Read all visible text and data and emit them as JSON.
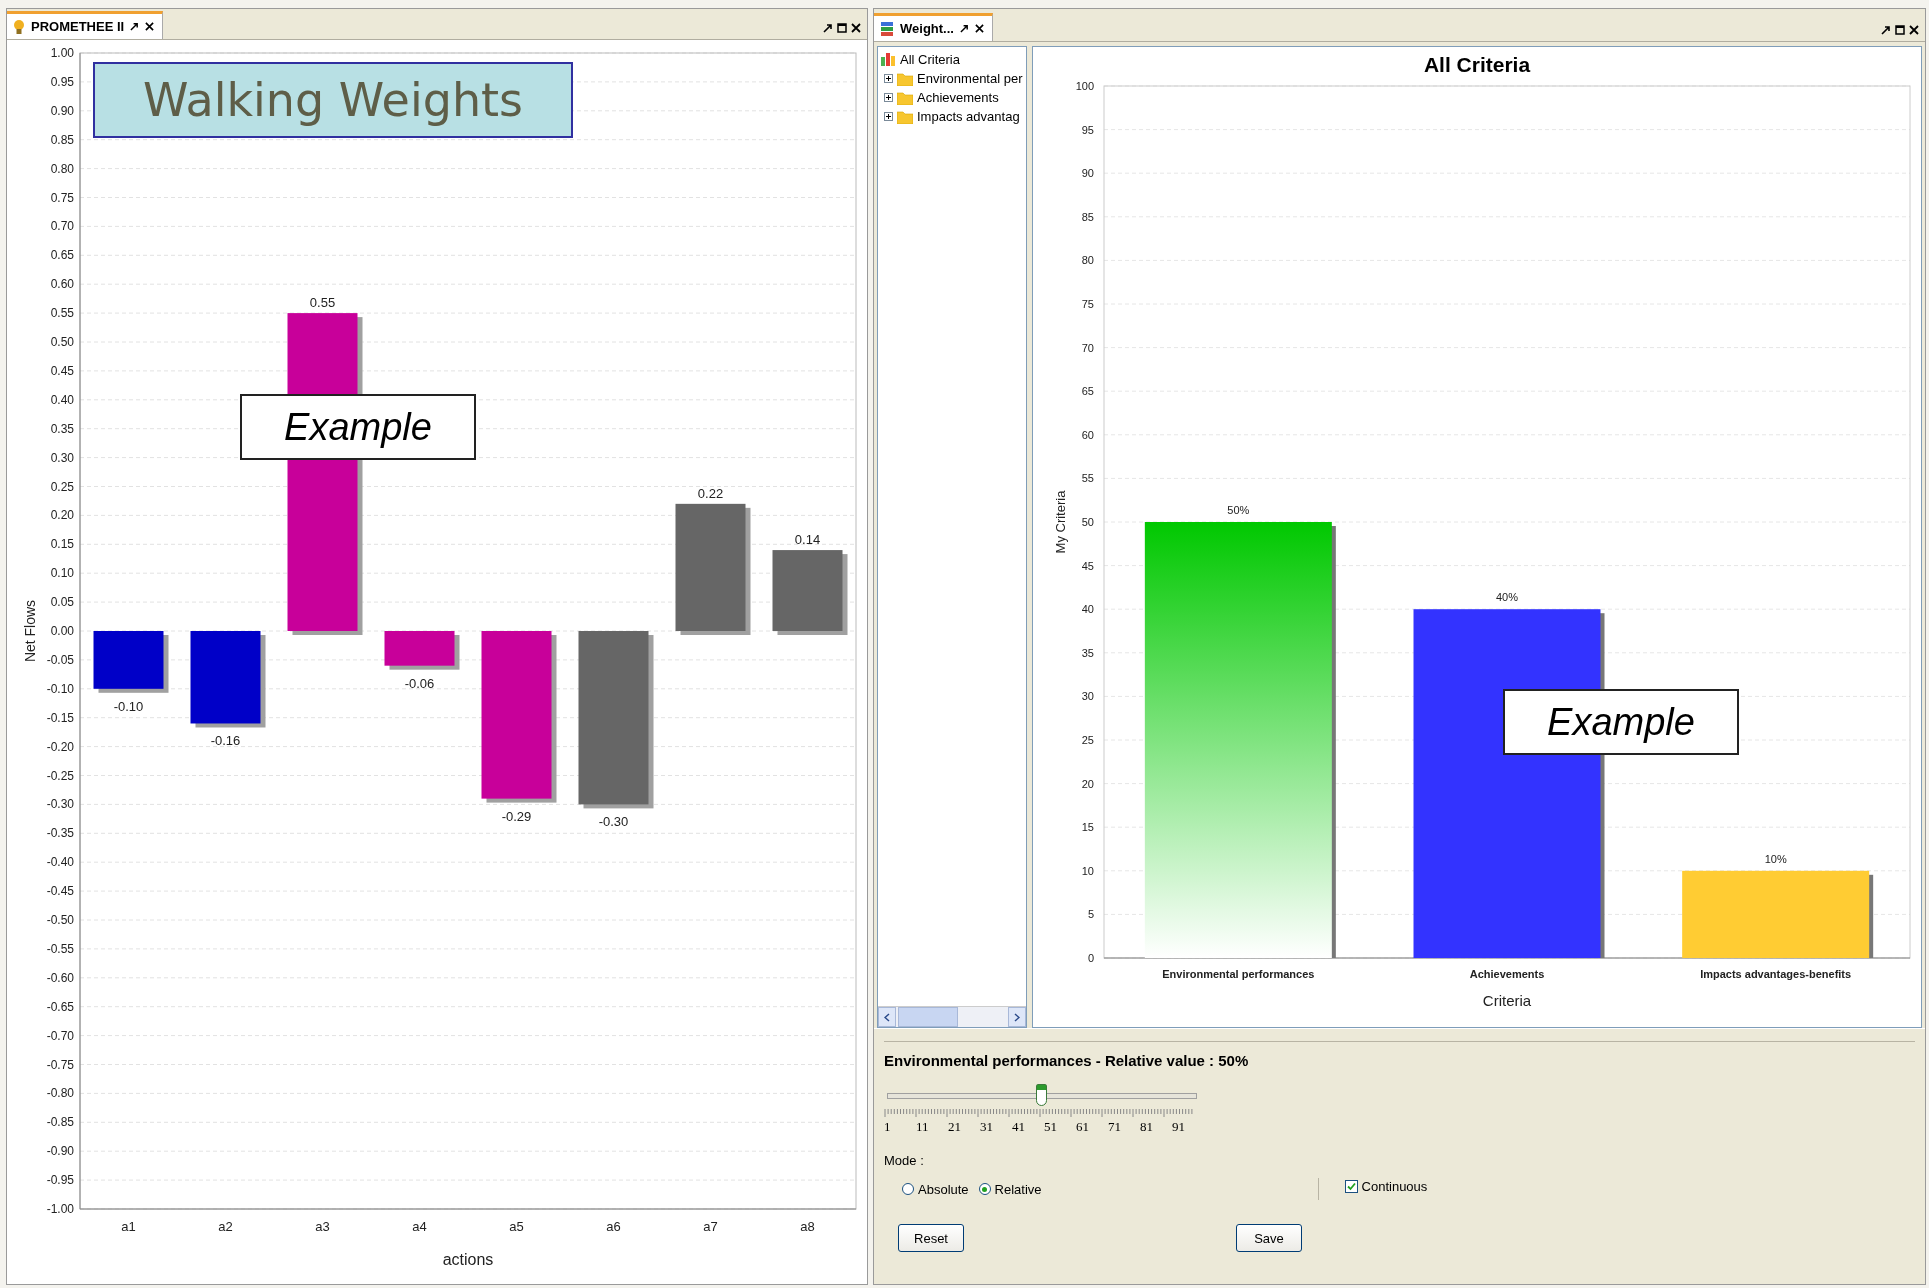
{
  "left_panel": {
    "tab": {
      "label": "PROMETHEE II",
      "selected": true
    },
    "banner": "Walking Weights",
    "callout": "Example",
    "chart_data": {
      "type": "bar",
      "xlabel": "actions",
      "ylabel": "Net Flows",
      "categories": [
        "a1",
        "a2",
        "a3",
        "a4",
        "a5",
        "a6",
        "a7",
        "a8"
      ],
      "series": [
        {
          "color": "#0000c8",
          "values": [
            -0.1,
            -0.16,
            null,
            null,
            null,
            null,
            null,
            null
          ]
        },
        {
          "color": "#c8009a",
          "values": [
            null,
            null,
            0.55,
            -0.06,
            -0.29,
            null,
            null,
            null
          ]
        },
        {
          "color": "#666666",
          "values": [
            null,
            null,
            null,
            null,
            null,
            -0.3,
            0.22,
            0.14
          ]
        }
      ],
      "value_labels": [
        "-0.10",
        "-0.16",
        "0.55",
        "-0.06",
        "-0.29",
        "-0.30",
        "0.22",
        "0.14"
      ],
      "ylim": [
        -1,
        1
      ],
      "grid": true,
      "yticks": [
        {
          "value": 1,
          "label": "1.00"
        },
        {
          "value": 0.95,
          "label": "0.95"
        },
        {
          "value": 0.9,
          "label": "0.90"
        },
        {
          "value": 0.85,
          "label": "0.85"
        },
        {
          "value": 0.8,
          "label": "0.80"
        },
        {
          "value": 0.75,
          "label": "0.75"
        },
        {
          "value": 0.7,
          "label": "0.70"
        },
        {
          "value": 0.65,
          "label": "0.65"
        },
        {
          "value": 0.6,
          "label": "0.60"
        },
        {
          "value": 0.55,
          "label": "0.55"
        },
        {
          "value": 0.5,
          "label": "0.50"
        },
        {
          "value": 0.45,
          "label": "0.45"
        },
        {
          "value": 0.4,
          "label": "0.40"
        },
        {
          "value": 0.35,
          "label": "0.35"
        },
        {
          "value": 0.3,
          "label": "0.30"
        },
        {
          "value": 0.25,
          "label": "0.25"
        },
        {
          "value": 0.2,
          "label": "0.20"
        },
        {
          "value": 0.15,
          "label": "0.15"
        },
        {
          "value": 0.1,
          "label": "0.10"
        },
        {
          "value": 0.05,
          "label": "0.05"
        },
        {
          "value": 0,
          "label": "0.00"
        },
        {
          "value": -0.05,
          "label": "-0.05"
        },
        {
          "value": -0.1,
          "label": "-0.10"
        },
        {
          "value": -0.15,
          "label": "-0.15"
        },
        {
          "value": -0.2,
          "label": "-0.20"
        },
        {
          "value": -0.25,
          "label": "-0.25"
        },
        {
          "value": -0.3,
          "label": "-0.30"
        },
        {
          "value": -0.35,
          "label": "-0.35"
        },
        {
          "value": -0.4,
          "label": "-0.40"
        },
        {
          "value": -0.45,
          "label": "-0.45"
        },
        {
          "value": -0.5,
          "label": "-0.50"
        },
        {
          "value": -0.55,
          "label": "-0.55"
        },
        {
          "value": -0.6,
          "label": "-0.60"
        },
        {
          "value": -0.65,
          "label": "-0.65"
        },
        {
          "value": -0.7,
          "label": "-0.70"
        },
        {
          "value": -0.75,
          "label": "-0.75"
        },
        {
          "value": -0.8,
          "label": "-0.80"
        },
        {
          "value": -0.85,
          "label": "-0.85"
        },
        {
          "value": -0.9,
          "label": "-0.90"
        },
        {
          "value": -0.95,
          "label": "-0.95"
        },
        {
          "value": -1,
          "label": "-1.00"
        }
      ]
    }
  },
  "right_panel": {
    "tab": {
      "label": "Weight...",
      "selected": true
    },
    "tree": [
      {
        "label": "All Criteria",
        "children": [
          {
            "label": "Environmental per",
            "expanded": false
          },
          {
            "label": "Achievements",
            "expanded": false
          },
          {
            "label": "Impacts advantag",
            "expanded": false
          }
        ]
      }
    ],
    "callout": "Example",
    "chart_data": {
      "type": "bar",
      "title": "All Criteria",
      "xlabel": "Criteria",
      "ylabel": "My Criteria",
      "categories": [
        "Environmental performances",
        "Achievements",
        "Impacts advantages-benefits"
      ],
      "series": [
        {
          "color": "#00c800",
          "values": [
            50,
            null,
            null
          ]
        },
        {
          "color": "#3333ff",
          "values": [
            null,
            40,
            null
          ]
        },
        {
          "color": "#ffcc33",
          "values": [
            null,
            null,
            10
          ]
        }
      ],
      "value_labels": [
        "50%",
        "40%",
        "10%"
      ],
      "ylim": [
        0,
        100
      ],
      "grid": true,
      "yticks": [
        0,
        5,
        10,
        15,
        20,
        25,
        30,
        35,
        40,
        45,
        50,
        55,
        60,
        65,
        70,
        75,
        80,
        85,
        90,
        95,
        100
      ]
    },
    "controls": {
      "heading": "Environmental performances - Relative value : 50%",
      "slider": {
        "level": 0.5,
        "tick_labels": [
          "1",
          "11",
          "21",
          "31",
          "41",
          "51",
          "61",
          "71",
          "81",
          "91"
        ]
      },
      "mode_label": "Mode :",
      "modes": [
        {
          "label": "Absolute",
          "selected": false
        },
        {
          "label": "Relative",
          "selected": true
        }
      ],
      "continuous": {
        "label": "Continuous",
        "checked": true
      },
      "buttons": [
        "Reset",
        "Save"
      ]
    }
  }
}
